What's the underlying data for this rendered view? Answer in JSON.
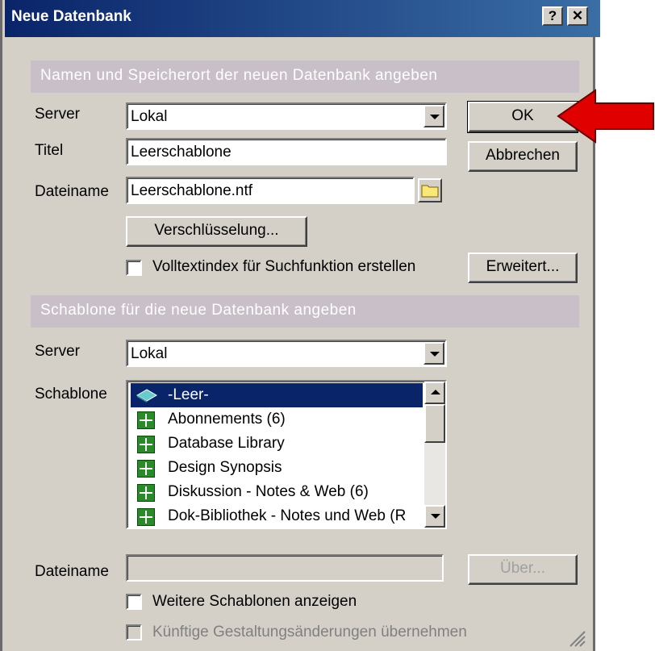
{
  "window": {
    "title": "Neue Datenbank",
    "help_button": "?",
    "close_button": "✕"
  },
  "section1": {
    "header": "Namen und Speicherort der neuen Datenbank angeben",
    "server_label": "Server",
    "server_value": "Lokal",
    "title_label": "Titel",
    "title_value": "Leerschablone",
    "filename_label": "Dateiname",
    "filename_value": "Leerschablone.ntf",
    "encryption_button": "Verschlüsselung...",
    "fulltext_checkbox_label": "Volltextindex für Suchfunktion erstellen",
    "ok_button": "OK",
    "cancel_button": "Abbrechen",
    "advanced_button": "Erweitert..."
  },
  "section2": {
    "header": "Schablone für die neue Datenbank angeben",
    "server_label": "Server",
    "server_value": "Lokal",
    "template_label": "Schablone",
    "templates": [
      {
        "label": "-Leer-",
        "icon": "book-icon",
        "selected": true
      },
      {
        "label": "Abonnements (6)",
        "icon": "notes-db-icon"
      },
      {
        "label": "Database Library",
        "icon": "notes-db-icon"
      },
      {
        "label": "Design Synopsis",
        "icon": "notes-db-icon"
      },
      {
        "label": "Diskussion - Notes & Web (6)",
        "icon": "notes-db-icon"
      },
      {
        "label": "Dok-Bibliothek - Notes und Web (R",
        "icon": "notes-db-icon"
      }
    ],
    "filename_label": "Dateiname",
    "filename_value": "",
    "about_button": "Über...",
    "more_templates_label": "Weitere Schablonen anzeigen",
    "inherit_label": "Künftige Gestaltungsänderungen übernehmen"
  },
  "colors": {
    "title_bar": "#0a246a",
    "section_header": "#c9bfc9",
    "dialog_bg": "#d4d0c8",
    "selection": "#0a246a",
    "annotation_arrow": "#e00000"
  }
}
